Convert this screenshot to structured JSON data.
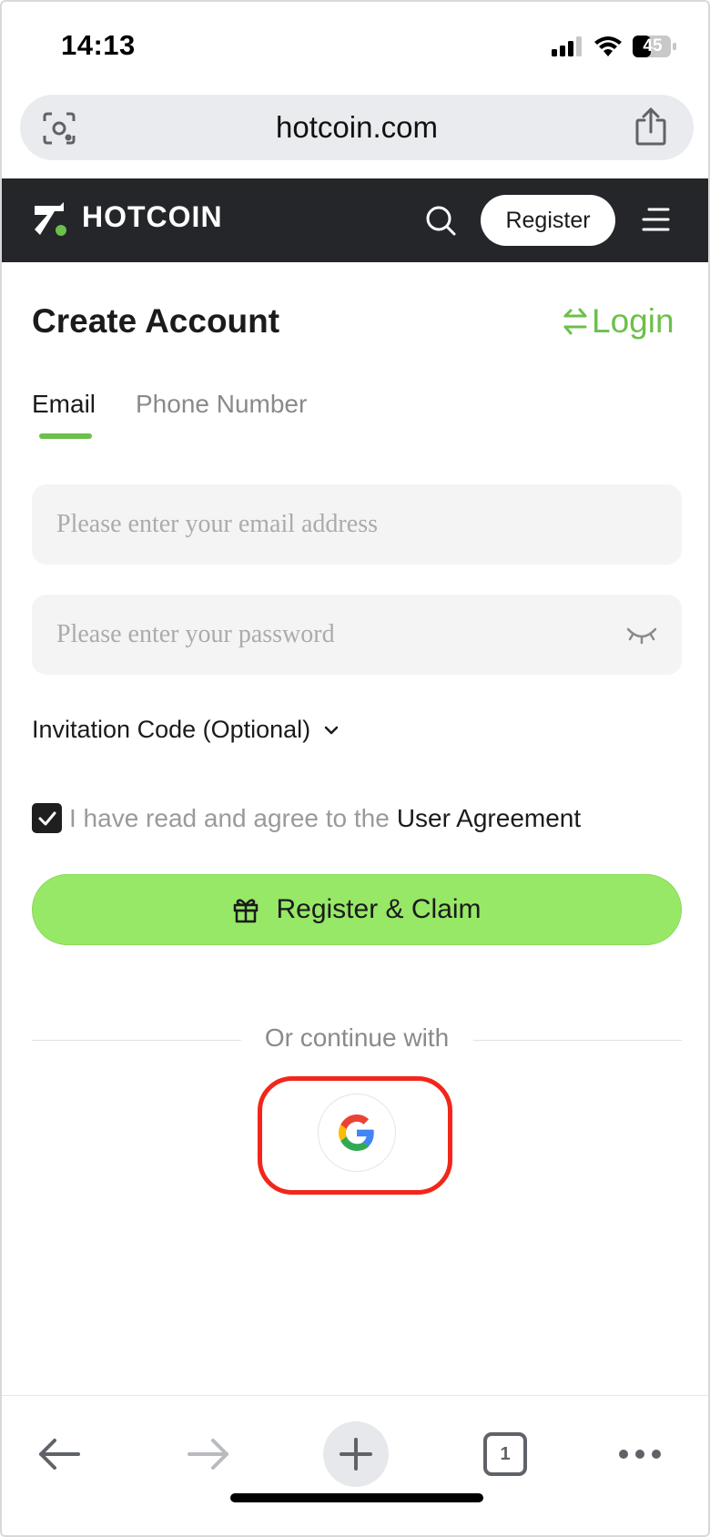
{
  "status_bar": {
    "time": "14:13",
    "battery": "45"
  },
  "browser": {
    "url": "hotcoin.com",
    "tabs_count": "1"
  },
  "site_header": {
    "logo_text": "HOTCOIN",
    "register_label": "Register"
  },
  "page": {
    "title": "Create Account",
    "login_label": "Login",
    "tabs": [
      {
        "label": "Email",
        "active": true
      },
      {
        "label": "Phone Number",
        "active": false
      }
    ],
    "email_placeholder": "Please enter your email address",
    "email_value": "",
    "password_placeholder": "Please enter your password",
    "password_value": "",
    "invitation_label": "Invitation Code (Optional)",
    "agreement_text": "I have read and agree to the",
    "agreement_link": "User Agreement",
    "agreement_checked": true,
    "cta_label": "Register & Claim",
    "divider_text": "Or continue with"
  },
  "colors": {
    "accent_green": "#6cc04a",
    "cta_green": "#97e867",
    "header_dark": "#24262a",
    "highlight_red": "#f2261b"
  },
  "icons": [
    "signal-icon",
    "wifi-icon",
    "battery-icon",
    "lens-icon",
    "share-icon",
    "hotcoin-logo-icon",
    "search-icon",
    "menu-icon",
    "swap-arrows-icon",
    "eye-closed-icon",
    "chevron-down-icon",
    "checkmark-icon",
    "gift-icon",
    "google-icon",
    "back-arrow-icon",
    "forward-arrow-icon",
    "plus-icon",
    "more-icon"
  ]
}
